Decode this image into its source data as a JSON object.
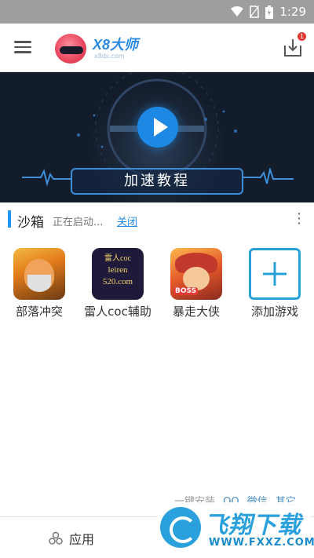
{
  "status_bar": {
    "time": "1:29"
  },
  "app_bar": {
    "logo_title": "X8大师",
    "logo_sub": "x8ds.com",
    "download_badge": "1"
  },
  "banner": {
    "label": "加速教程"
  },
  "sandbox": {
    "title": "沙箱",
    "status": "正在启动...",
    "close_label": "关闭",
    "more": "⋮"
  },
  "games": [
    {
      "label": "部落冲突",
      "icon": "clash-of-clans-icon"
    },
    {
      "label": "雷人coc辅助",
      "icon": "leiren-coc-icon",
      "icon_text": [
        "雷人coc",
        "leiren",
        "520.com"
      ]
    },
    {
      "label": "暴走大侠",
      "icon": "baozou-daxia-icon",
      "badge": "BOSS"
    },
    {
      "label": "添加游戏",
      "icon": "add-game-icon"
    }
  ],
  "bottom_links": [
    "一键安装",
    "QQ",
    "微信",
    "其它"
  ],
  "tab_bar": {
    "apps_label": "应用"
  },
  "watermark": {
    "title": "飞翔下载",
    "url": "WWW.FXXZ.COM"
  },
  "colors": {
    "accent": "#1e88e5",
    "status_bar": "#9e9e9e",
    "banner_bg": "#131c2b",
    "badge": "#e53935"
  }
}
